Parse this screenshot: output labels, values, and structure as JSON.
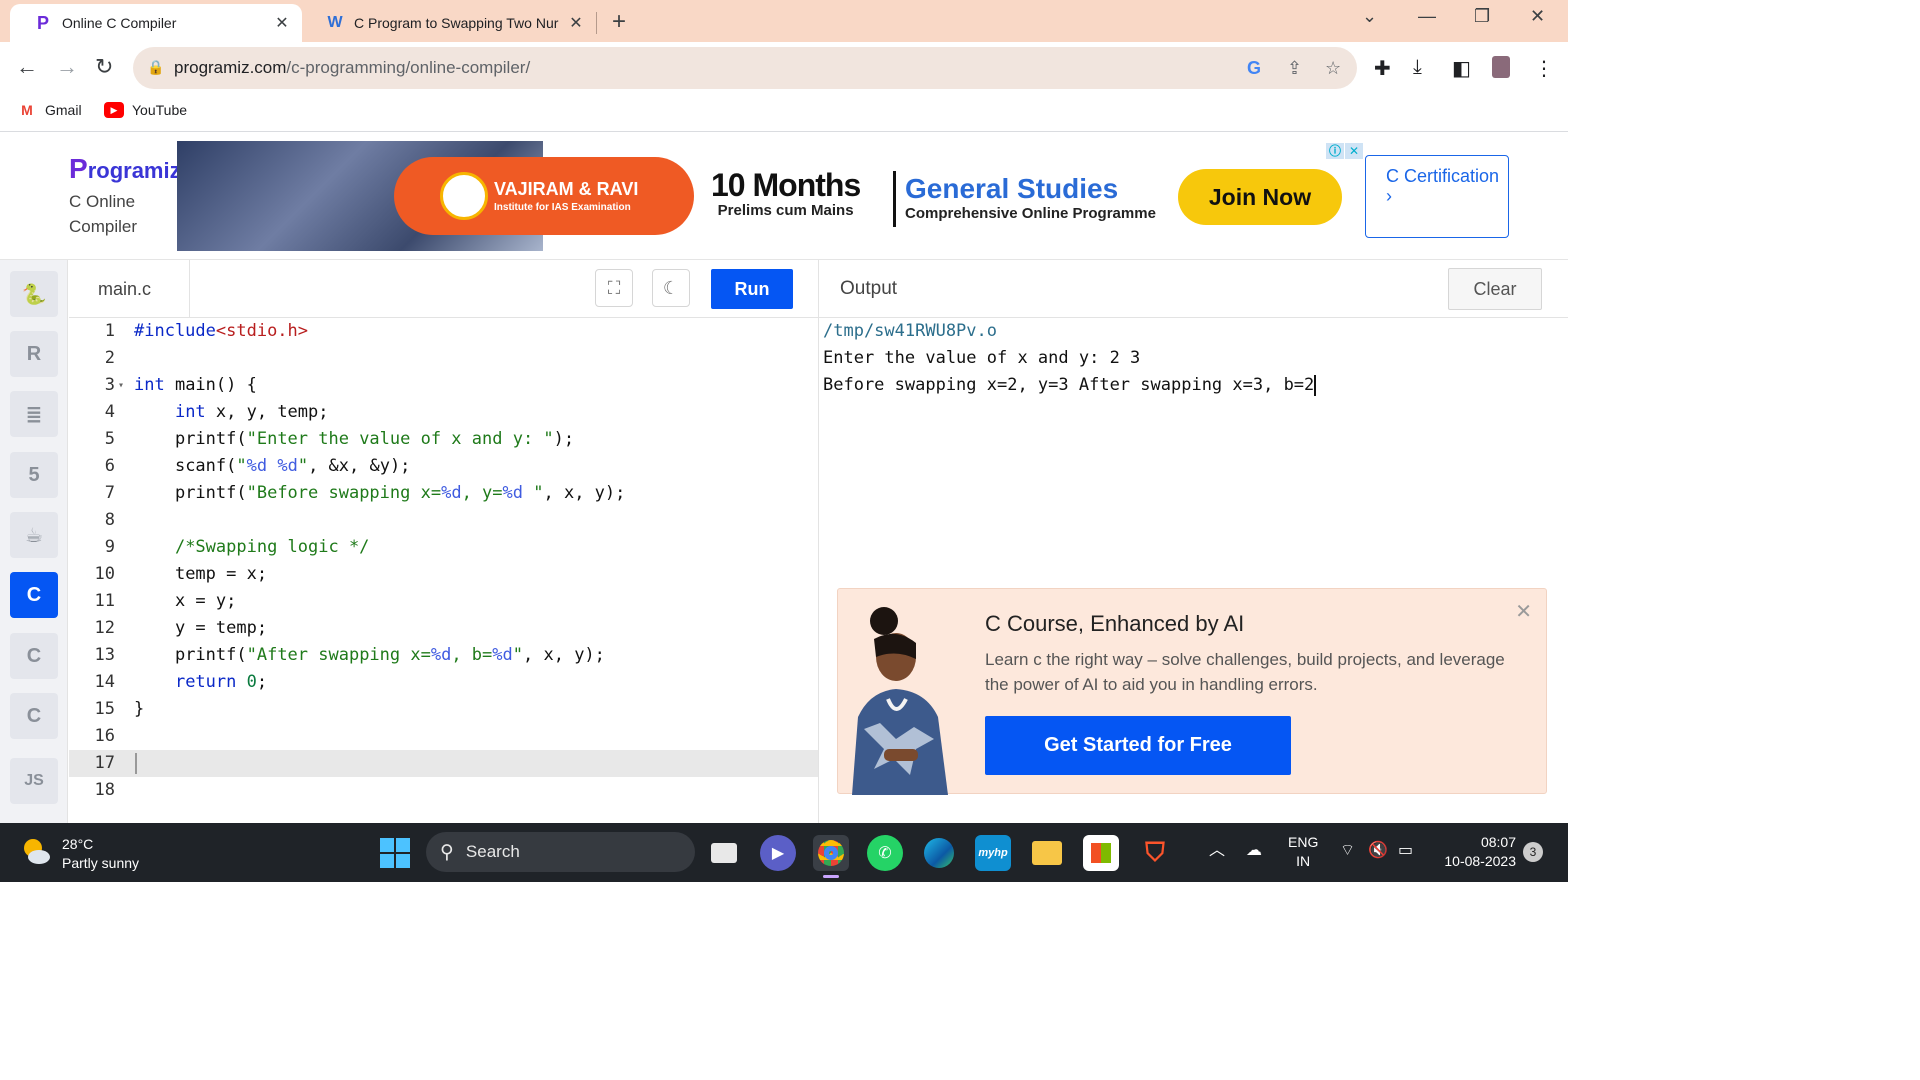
{
  "browser": {
    "tabs": [
      {
        "title": "Online C Compiler",
        "close": "✕"
      },
      {
        "title": "C Program to Swapping Two Nur",
        "close": "✕"
      }
    ],
    "new_tab": "+",
    "url_host": "programiz.com",
    "url_path": "/c-programming/online-compiler/",
    "bookmarks": [
      {
        "label": "Gmail"
      },
      {
        "label": "YouTube"
      }
    ]
  },
  "site": {
    "logo": "rogramiz",
    "logo_initial": "P",
    "subtitle_line1": "C Online",
    "subtitle_line2": "Compiler",
    "certification": "C Certification ›"
  },
  "ad": {
    "institute": "VAJIRAM & RAVI",
    "institute_sub": "Institute for IAS Examination",
    "months": "10 Months",
    "months_sub": "Prelims cum Mains",
    "gs": "General Studies",
    "gs_sub": "Comprehensive Online Programme",
    "cta": "Join Now"
  },
  "editor": {
    "filename": "main.c",
    "run_label": "Run",
    "lines": [
      {
        "n": "1"
      },
      {
        "n": "2"
      },
      {
        "n": "3"
      },
      {
        "n": "4"
      },
      {
        "n": "5"
      },
      {
        "n": "6"
      },
      {
        "n": "7"
      },
      {
        "n": "8"
      },
      {
        "n": "9"
      },
      {
        "n": "10"
      },
      {
        "n": "11"
      },
      {
        "n": "12"
      },
      {
        "n": "13"
      },
      {
        "n": "14"
      },
      {
        "n": "15"
      },
      {
        "n": "16"
      },
      {
        "n": "17"
      },
      {
        "n": "18"
      }
    ],
    "code": {
      "l1_inc": "#include",
      "l1_hdr": "<stdio.h>",
      "l3": "int main() {",
      "l4_kw": "int",
      "l4_rest": " x, y, temp;",
      "l5_a": "printf(",
      "l5_s": "\"Enter the value of x and y: \"",
      "l5_b": ");",
      "l6_a": "scanf(",
      "l6_s1": "\"",
      "l6_f": "%d %d",
      "l6_s2": "\"",
      "l6_b": ", &x, &y);",
      "l7_a": "printf(",
      "l7_s1": "\"Before swapping x=",
      "l7_f1": "%d",
      "l7_s2": ", y=",
      "l7_f2": "%d",
      "l7_s3": " \"",
      "l7_b": ", x, y);",
      "l9": "/*Swapping logic */",
      "l10": "temp = x;",
      "l11": "x = y;",
      "l12": "y = temp;",
      "l13_a": "printf(",
      "l13_s1": "\"After swapping x=",
      "l13_f1": "%d",
      "l13_s2": ", b=",
      "l13_f2": "%d",
      "l13_s3": "\"",
      "l13_b": ", x, y);",
      "l14_kw": "return",
      "l14_num": "0",
      "l14_b": ";",
      "l15": "}"
    }
  },
  "output": {
    "title": "Output",
    "clear_label": "Clear",
    "lines": [
      "/tmp/sw41RWU8Pv.o",
      "Enter the value of x and y: 2 3",
      "Before swapping x=2, y=3 After swapping x=3, b=2"
    ]
  },
  "promo": {
    "title": "C Course, Enhanced by AI",
    "text": "Learn c the right way – solve challenges, build projects, and leverage the power of AI to aid you in handling errors.",
    "cta": "Get Started for Free"
  },
  "taskbar": {
    "temp": "28°C",
    "weather": "Partly sunny",
    "search": "Search",
    "lang1": "ENG",
    "lang2": "IN",
    "time": "08:07",
    "date": "10-08-2023",
    "notifications": "3"
  },
  "langs": [
    "python-icon",
    "r-icon",
    "sql-icon",
    "html-icon",
    "java-icon",
    "c-icon",
    "cpp-icon",
    "csharp-icon",
    "js-icon"
  ],
  "colors": {
    "accent": "#0556f3",
    "tabbar": "#f9d8c6",
    "promo_bg": "#fde8dc"
  }
}
